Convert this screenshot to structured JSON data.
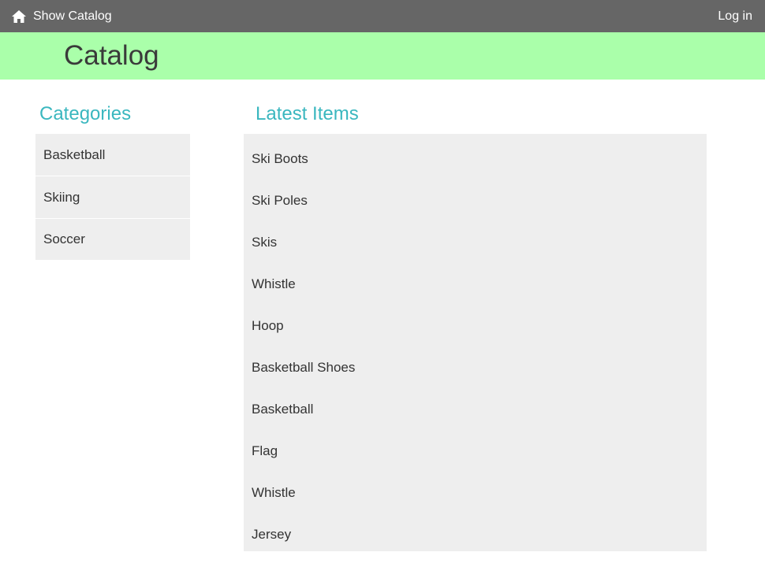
{
  "nav": {
    "home_label": "Show Catalog",
    "home_icon": "home-icon",
    "login_label": "Log in"
  },
  "banner": {
    "title": "Catalog"
  },
  "categories": {
    "title": "Categories",
    "items": [
      "Basketball",
      "Skiing",
      "Soccer"
    ]
  },
  "latest": {
    "title": "Latest Items",
    "items": [
      "Ski Boots",
      "Ski Poles",
      "Skis",
      "Whistle",
      "Hoop",
      "Basketball Shoes",
      "Basketball",
      "Flag",
      "Whistle",
      "Jersey"
    ]
  },
  "colors": {
    "topbar": "#666666",
    "banner": "#aaffaa",
    "accent": "#3ab7bf",
    "panel": "#eeeeee"
  }
}
